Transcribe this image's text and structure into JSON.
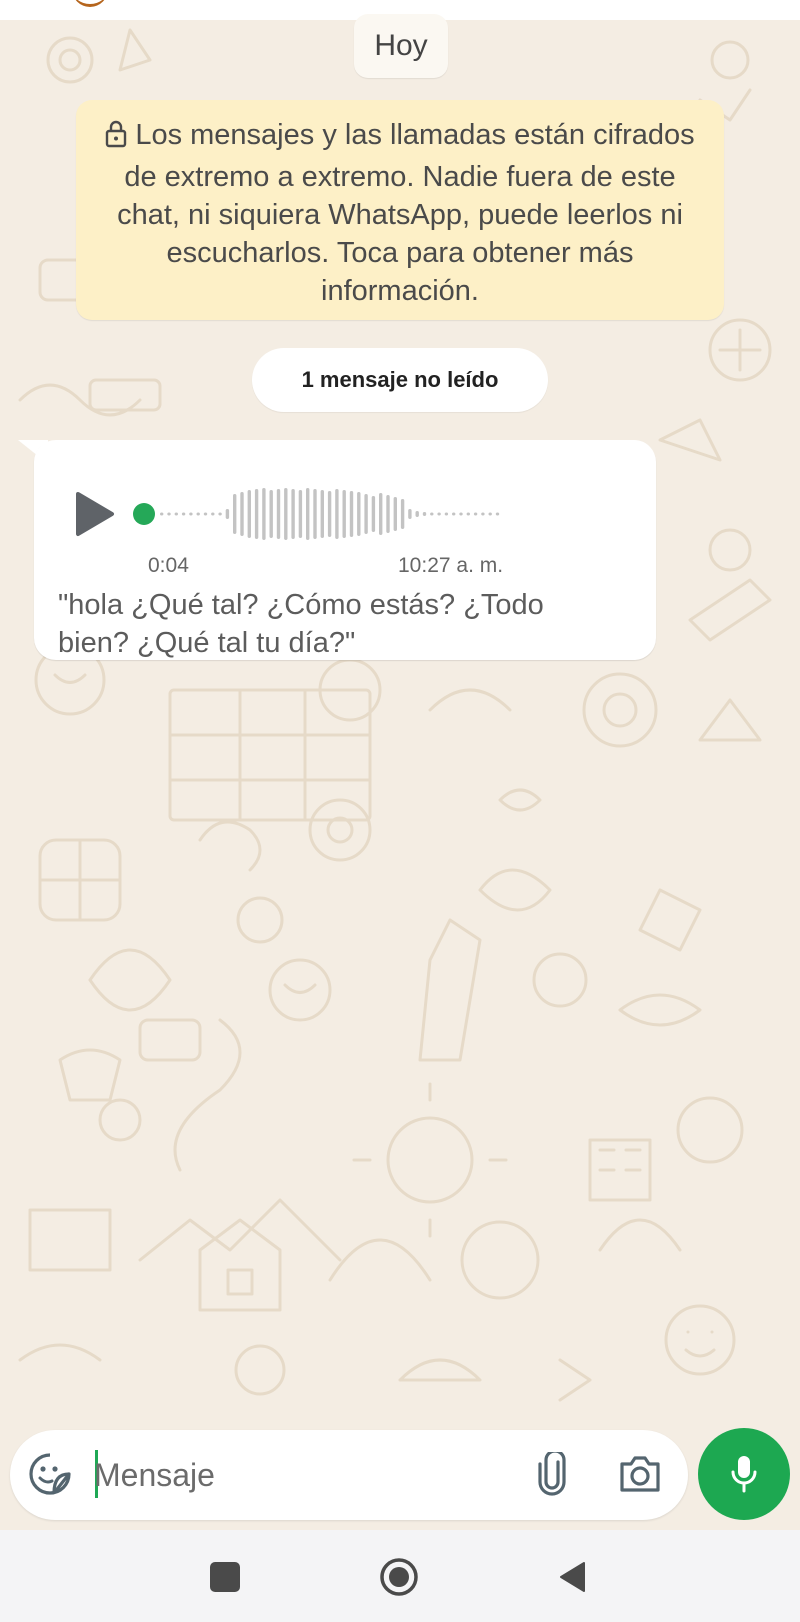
{
  "chat": {
    "date_label": "Hoy",
    "encryption_notice": "Los mensajes y las llamadas están cifrados de extremo a extremo. Nadie fuera de este chat, ni siquiera WhatsApp, puede leerlos ni escucharlos. Toca para obtener más información.",
    "unread_label": "1 mensaje no leído",
    "messages": [
      {
        "type": "voice",
        "duration": "0:04",
        "time": "10:27 a. m.",
        "transcript": "\"hola ¿Qué tal? ¿Cómo estás? ¿Todo bien? ¿Qué tal tu día?\"",
        "playback_progress": 0
      }
    ]
  },
  "composer": {
    "placeholder": "Mensaje",
    "value": ""
  },
  "icons": {
    "lock": "lock-icon",
    "play": "play-icon",
    "emoji": "sticker-emoji-icon",
    "attach": "paperclip-icon",
    "camera": "camera-icon",
    "mic": "microphone-icon",
    "recents": "square-icon",
    "home": "circle-home-icon",
    "back": "triangle-back-icon"
  },
  "colors": {
    "accent": "#1da851",
    "chat_background": "#f4ede3",
    "notice_background": "#fdf0c7",
    "bubble_background": "#ffffff",
    "progress_dot": "#25a858"
  }
}
